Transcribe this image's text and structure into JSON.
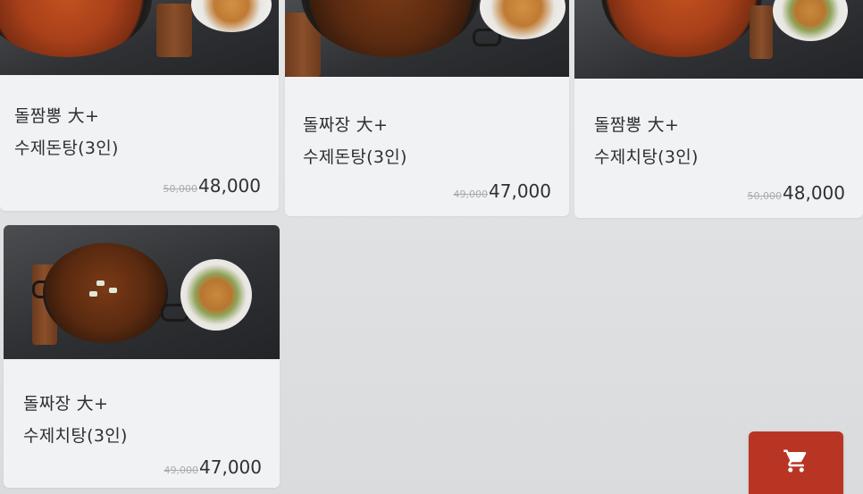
{
  "menu": {
    "items": [
      {
        "name": "돌짬뽕 大+\n수제돈탕(3인)",
        "original_price": "50,000",
        "price": "48,000"
      },
      {
        "name": "돌짜장 大+\n수제돈탕(3인)",
        "original_price": "49,000",
        "price": "47,000"
      },
      {
        "name": "돌짬뽕 大+\n수제치탕(3인)",
        "original_price": "50,000",
        "price": "48,000"
      },
      {
        "name": "돌짜장 大+\n수제치탕(3인)",
        "original_price": "49,000",
        "price": "47,000"
      }
    ]
  },
  "cart": {
    "icon": "shopping-cart-icon",
    "color": "#b83524"
  }
}
